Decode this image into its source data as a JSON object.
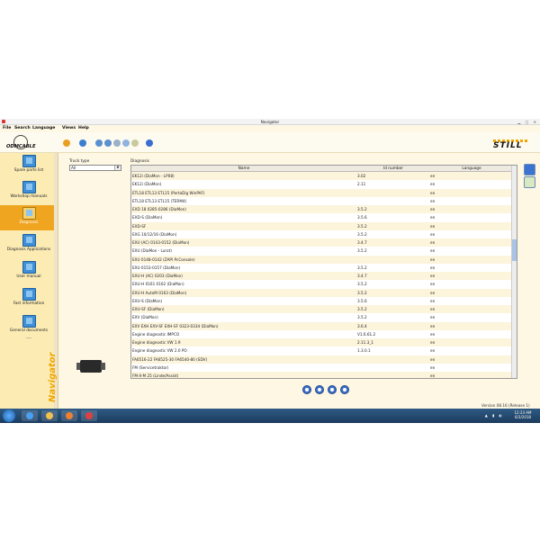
{
  "window": {
    "title": "Navigator"
  },
  "menu": {
    "items": [
      "File",
      "Search",
      "Language",
      "Views",
      "Help"
    ]
  },
  "brand": {
    "left_logo": "ODMCABLE",
    "right_logo": "STILL",
    "vertical": "Navigator"
  },
  "sidebar": {
    "items": [
      {
        "label": "Spare parts list",
        "active": false
      },
      {
        "label": "Workshop manuals",
        "active": false
      },
      {
        "label": "Diagnosis",
        "active": true
      },
      {
        "label": "Diagnosis Applications",
        "active": false
      },
      {
        "label": "User manual",
        "active": false
      },
      {
        "label": "Fast information",
        "active": false
      },
      {
        "label": "General documents",
        "active": false
      }
    ],
    "more": "----"
  },
  "truck_type": {
    "label": "Truck type",
    "value": "All"
  },
  "diagnosis": {
    "label": "Diagnosis",
    "columns": [
      "Name",
      "Id number",
      "Language"
    ],
    "rows": [
      [
        "EK12i (DiaMon - LP08)",
        "3.02",
        "en"
      ],
      [
        "EK12i (DiaMon)",
        "2.11",
        "en"
      ],
      [
        "ETL18 ETL13 ETL15 (PortaDig WinPAF)",
        "",
        "en"
      ],
      [
        "ETL18 ETL13 ETL15 (TERM4)",
        "",
        "en"
      ],
      [
        "EXD 18 0285-0286 (DiaMon)",
        "3.5.2",
        "en"
      ],
      [
        "EXD-S (DiaMon)",
        "3.5.6",
        "en"
      ],
      [
        "EXD-SF",
        "3.5.2",
        "en"
      ],
      [
        "EXG 10/12/16 (DiaMon)",
        "3.5.2",
        "en"
      ],
      [
        "EXU (AC) 0143-0152 (DiaMon)",
        "3.4.7",
        "en"
      ],
      [
        "EXU (DiaMon - Lurot)",
        "3.5.2",
        "en"
      ],
      [
        "EXU 0148-0142 (ZAPI PcConsole)",
        "",
        "en"
      ],
      [
        "EXU 0153-0157 (DiaMon)",
        "3.5.2",
        "en"
      ],
      [
        "EXU-H (AC) 0203 (DiaMon)",
        "3.4.7",
        "en"
      ],
      [
        "EXU-H 0161 0162 (DiaMon)",
        "3.5.2",
        "en"
      ],
      [
        "EXU-H AutoM 0163 (DiaMon)",
        "3.5.2",
        "en"
      ],
      [
        "EXU-S (DiaMon)",
        "3.5.6",
        "en"
      ],
      [
        "EXU-SF (DiaMon)",
        "3.5.2",
        "en"
      ],
      [
        "EXV (DiaMon)",
        "3.5.2",
        "en"
      ],
      [
        "EXV EXH EXV-SF EXH-SF 0323-0334 (DiaMon)",
        "3.6.4",
        "en"
      ],
      [
        "Engine diagnostic IMPCO",
        "V1.6.61.2",
        "en"
      ],
      [
        "Engine diagnostic VW 1.9",
        "2.11.3_1",
        "en"
      ],
      [
        "Engine diagnostic VW 2.0 PO",
        "1.3.0.1",
        "en"
      ],
      [
        "FA6516-22 FA6525-30 FA6540-80 (SDV)",
        "",
        "en"
      ],
      [
        "FM (Servicetraktor)",
        "",
        "en"
      ],
      [
        "FM-X-M 25 (Linde/Assist)",
        "",
        "en"
      ]
    ]
  },
  "status": {
    "version": "Version 08.16 (Release 1)"
  },
  "taskbar": {
    "time": "12:23 AM",
    "date": "6/3/2018"
  },
  "colors": {
    "accent": "#f0a520",
    "sidebar_bg": "#fcecb4",
    "taskbar": "#1c3b5e"
  }
}
